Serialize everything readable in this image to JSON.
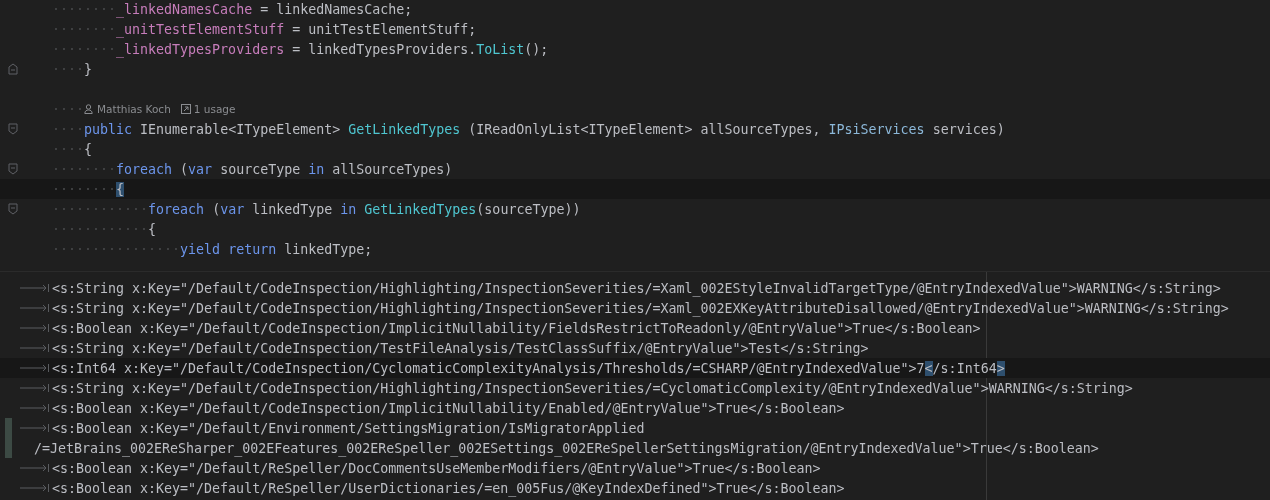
{
  "code_editor": {
    "lines": [
      {
        "kind": "code",
        "indent": "········",
        "tokens": [
          {
            "kind": "field",
            "text": "_linkedNamesCache"
          },
          {
            "kind": "plain",
            "text": " = linkedNamesCache;"
          }
        ]
      },
      {
        "kind": "code",
        "indent": "········",
        "tokens": [
          {
            "kind": "field",
            "text": "_unitTestElementStuff"
          },
          {
            "kind": "plain",
            "text": " = unitTestElementStuff;"
          }
        ]
      },
      {
        "kind": "code",
        "indent": "········",
        "tokens": [
          {
            "kind": "field",
            "text": "_linkedTypesProviders"
          },
          {
            "kind": "plain",
            "text": " = linkedTypesProviders."
          },
          {
            "kind": "method",
            "text": "ToList"
          },
          {
            "kind": "plain",
            "text": "();"
          }
        ]
      },
      {
        "kind": "code",
        "indent": "····",
        "fold_end": true,
        "tokens": [
          {
            "kind": "plain",
            "text": "}"
          }
        ]
      },
      {
        "kind": "blank"
      },
      {
        "kind": "codevision",
        "indent": "····",
        "author": "Matthias Koch",
        "usages": "1 usage"
      },
      {
        "kind": "code",
        "indent": "····",
        "fold_start": true,
        "tokens": [
          {
            "kind": "keyword",
            "text": "public"
          },
          {
            "kind": "plain",
            "text": " IEnumerable<ITypeElement> "
          },
          {
            "kind": "method",
            "text": "GetLinkedTypes"
          },
          {
            "kind": "plain",
            "text": " (IReadOnlyList<ITypeElement> allSourceTypes, "
          },
          {
            "kind": "interface",
            "text": "IPsiServices"
          },
          {
            "kind": "plain",
            "text": " services)"
          }
        ]
      },
      {
        "kind": "code",
        "indent": "····",
        "tokens": [
          {
            "kind": "plain",
            "text": "{"
          }
        ]
      },
      {
        "kind": "code",
        "indent": "········",
        "fold_start": true,
        "tokens": [
          {
            "kind": "keyword",
            "text": "foreach"
          },
          {
            "kind": "plain",
            "text": " ("
          },
          {
            "kind": "keyword",
            "text": "var"
          },
          {
            "kind": "plain",
            "text": " sourceType "
          },
          {
            "kind": "keyword",
            "text": "in"
          },
          {
            "kind": "plain",
            "text": " allSourceTypes)"
          }
        ]
      },
      {
        "kind": "code",
        "indent": "········",
        "current": true,
        "tokens": [
          {
            "kind": "match",
            "text": "{"
          }
        ]
      },
      {
        "kind": "code",
        "indent": "············",
        "fold_start": true,
        "tokens": [
          {
            "kind": "keyword",
            "text": "foreach"
          },
          {
            "kind": "plain",
            "text": " ("
          },
          {
            "kind": "keyword",
            "text": "var"
          },
          {
            "kind": "plain",
            "text": " linkedType "
          },
          {
            "kind": "keyword",
            "text": "in"
          },
          {
            "kind": "method",
            "text": " GetLinkedTypes"
          },
          {
            "kind": "plain",
            "text": "(sourceType))"
          }
        ]
      },
      {
        "kind": "code",
        "indent": "············",
        "tokens": [
          {
            "kind": "plain",
            "text": "{"
          }
        ]
      },
      {
        "kind": "code",
        "indent": "················",
        "tokens": [
          {
            "kind": "keyword",
            "text": "yield return"
          },
          {
            "kind": "plain",
            "text": " linkedType;"
          }
        ]
      }
    ]
  },
  "settings_editor": {
    "lines": [
      {
        "kind": "tab",
        "tokens": [
          {
            "kind": "plain",
            "text": "<s:String x:Key=\"/Default/CodeInspection/Highlighting/InspectionSeverities/=Xaml_002EStyleInvalidTargetType/@EntryIndexedValue\">WARNING</s:String>"
          }
        ]
      },
      {
        "kind": "tab",
        "tokens": [
          {
            "kind": "plain",
            "text": "<s:String x:Key=\"/Default/CodeInspection/Highlighting/InspectionSeverities/=Xaml_002EXKeyAttributeDisallowed/@EntryIndexedValue\">WARNING</s:String>"
          }
        ]
      },
      {
        "kind": "tab",
        "tokens": [
          {
            "kind": "plain",
            "text": "<s:Boolean x:Key=\"/Default/CodeInspection/ImplicitNullability/FieldsRestrictToReadonly/@EntryValue\">True</s:Boolean>"
          }
        ]
      },
      {
        "kind": "tab",
        "tokens": [
          {
            "kind": "plain",
            "text": "<s:String x:Key=\"/Default/CodeInspection/TestFileAnalysis/TestClassSuffix/@EntryValue\">Test</s:String>"
          }
        ]
      },
      {
        "kind": "tab",
        "current": true,
        "tokens": [
          {
            "kind": "plain",
            "text": "<s:Int64 x:Key=\"/Default/CodeInspection/CyclomaticComplexityAnalysis/Thresholds/=CSHARP/@EntryIndexedValue\">7"
          },
          {
            "kind": "match",
            "text": "<"
          },
          {
            "kind": "plain",
            "text": "/s:Int64"
          },
          {
            "kind": "match",
            "text": ">"
          }
        ]
      },
      {
        "kind": "tab",
        "tokens": [
          {
            "kind": "plain",
            "text": "<s:String x:Key=\"/Default/CodeInspection/Highlighting/InspectionSeverities/=CyclomaticComplexity/@EntryIndexedValue\">WARNING</s:String>"
          }
        ]
      },
      {
        "kind": "tab",
        "tokens": [
          {
            "kind": "plain",
            "text": "<s:Boolean x:Key=\"/Default/CodeInspection/ImplicitNullability/Enabled/@EntryValue\">True</s:Boolean>"
          }
        ]
      },
      {
        "kind": "tab",
        "changed": true,
        "tokens": [
          {
            "kind": "plain",
            "text": "<s:Boolean x:Key=\"/Default/Environment/SettingsMigration/IsMigratorApplied"
          }
        ]
      },
      {
        "kind": "wrap",
        "changed": true,
        "tokens": [
          {
            "kind": "plain",
            "text": "/=JetBrains_002EReSharper_002EFeatures_002EReSpeller_002ESettings_002EReSpellerSettingsMigration/@EntryIndexedValue\">True</s:Boolean>"
          }
        ]
      },
      {
        "kind": "tab",
        "tokens": [
          {
            "kind": "plain",
            "text": "<s:Boolean x:Key=\"/Default/ReSpeller/DocCommentsUseMemberModifiers/@EntryValue\">True</s:Boolean>"
          }
        ]
      },
      {
        "kind": "tab",
        "tokens": [
          {
            "kind": "plain",
            "text": "<s:Boolean x:Key=\"/Default/ReSpeller/UserDictionaries/=en_005Fus/@KeyIndexDefined\">True</s:Boolean>"
          }
        ]
      }
    ]
  }
}
